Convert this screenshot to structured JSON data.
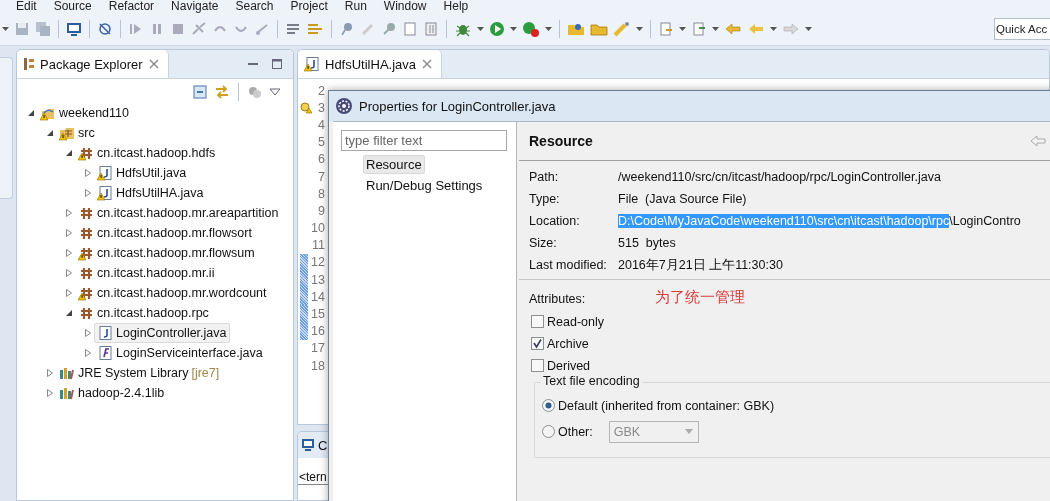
{
  "menu": [
    "Edit",
    "Source",
    "Refactor",
    "Navigate",
    "Search",
    "Project",
    "Run",
    "Window",
    "Help"
  ],
  "quick_access": {
    "placeholder": "Quick Acc"
  },
  "package_explorer": {
    "title": "Package Explorer",
    "tree": [
      {
        "label": "weekend110",
        "kind": "project",
        "expanded": true,
        "warning": true,
        "selected": false,
        "children": [
          {
            "label": "src",
            "kind": "source-folder",
            "expanded": true,
            "warning": true,
            "selected": false,
            "children": [
              {
                "label": "cn.itcast.hadoop.hdfs",
                "kind": "package",
                "expanded": true,
                "warning": true,
                "selected": false,
                "children": [
                  {
                    "label": "HdfsUtil.java",
                    "kind": "class",
                    "expanded": false,
                    "warning": true,
                    "selected": false
                  },
                  {
                    "label": "HdfsUtilHA.java",
                    "kind": "class",
                    "expanded": false,
                    "warning": true,
                    "selected": false
                  }
                ]
              },
              {
                "label": "cn.itcast.hadoop.mr.areapartition",
                "kind": "package",
                "expanded": false,
                "warning": false,
                "selected": false
              },
              {
                "label": "cn.itcast.hadoop.mr.flowsort",
                "kind": "package",
                "expanded": false,
                "warning": false,
                "selected": false
              },
              {
                "label": "cn.itcast.hadoop.mr.flowsum",
                "kind": "package",
                "expanded": false,
                "warning": true,
                "selected": false
              },
              {
                "label": "cn.itcast.hadoop.mr.ii",
                "kind": "package",
                "expanded": false,
                "warning": false,
                "selected": false
              },
              {
                "label": "cn.itcast.hadoop.mr.wordcount",
                "kind": "package",
                "expanded": false,
                "warning": true,
                "selected": false
              },
              {
                "label": "cn.itcast.hadoop.rpc",
                "kind": "package",
                "expanded": true,
                "warning": false,
                "selected": false,
                "children": [
                  {
                    "label": "LoginController.java",
                    "kind": "class",
                    "expanded": false,
                    "warning": false,
                    "selected": true
                  },
                  {
                    "label": "LoginServiceinterface.java",
                    "kind": "interface",
                    "expanded": false,
                    "warning": false,
                    "selected": false
                  }
                ]
              }
            ]
          },
          {
            "label": "JRE System Library",
            "decoration": "[jre7]",
            "kind": "library",
            "expanded": false,
            "warning": false,
            "selected": false
          },
          {
            "label": "hadoop-2.4.1lib",
            "kind": "library",
            "expanded": false,
            "warning": false,
            "selected": false
          }
        ]
      }
    ]
  },
  "editor": {
    "tab": "HdfsUtilHA.java",
    "lines": [
      {
        "number": "2",
        "marked": false,
        "warning": false
      },
      {
        "number": "3",
        "marked": false,
        "warning": true
      },
      {
        "number": "4",
        "marked": false,
        "warning": false
      },
      {
        "number": "5",
        "marked": false,
        "warning": false
      },
      {
        "number": "6",
        "marked": false,
        "warning": false
      },
      {
        "number": "7",
        "marked": false,
        "warning": false
      },
      {
        "number": "8",
        "marked": false,
        "warning": false
      },
      {
        "number": "9",
        "marked": false,
        "warning": false
      },
      {
        "number": "10",
        "marked": false,
        "warning": false
      },
      {
        "number": "11",
        "marked": false,
        "warning": false
      },
      {
        "number": "12",
        "marked": true,
        "warning": false
      },
      {
        "number": "13",
        "marked": true,
        "warning": false
      },
      {
        "number": "14",
        "marked": true,
        "warning": false
      },
      {
        "number": "15",
        "marked": true,
        "warning": false
      },
      {
        "number": "16",
        "marked": true,
        "warning": false
      },
      {
        "number": "17",
        "marked": false,
        "warning": false
      },
      {
        "number": "18",
        "marked": false,
        "warning": false
      }
    ]
  },
  "bottom_panel": {
    "tab": "C",
    "line": "<tern"
  },
  "dialog": {
    "title": "Properties for LoginController.java",
    "filter": {
      "placeholder": "type filter text"
    },
    "pages": [
      {
        "label": "Resource",
        "selected": true
      },
      {
        "label": "Run/Debug Settings",
        "selected": false
      }
    ],
    "heading": "Resource",
    "properties": [
      {
        "label": "Path:",
        "value": "/weekend110/src/cn/itcast/hadoop/rpc/LoginController.java"
      },
      {
        "label": "Type:",
        "value": "File  (Java Source File)"
      },
      {
        "label": "Location:",
        "selected_value": "D:\\Code\\MyJavaCode\\weekend110\\src\\cn\\itcast\\hadoop\\rpc",
        "value": "\\LoginContro"
      },
      {
        "label": "Size:",
        "value": "515  bytes"
      },
      {
        "label": "Last modified:",
        "value": "2016年7月21日 上午11:30:30"
      }
    ],
    "attributes_label": "Attributes:",
    "annotation": "为了统一管理",
    "attributes": [
      {
        "label": "Read-only",
        "checked": false
      },
      {
        "label": "Archive",
        "checked": true
      },
      {
        "label": "Derived",
        "checked": false
      }
    ],
    "encoding": {
      "title": "Text file encoding",
      "options": [
        {
          "label": "Default (inherited from container: GBK)",
          "selected": true
        },
        {
          "label": "Other:",
          "selected": false
        }
      ],
      "combo": {
        "value": "GBK",
        "disabled": true
      }
    }
  }
}
